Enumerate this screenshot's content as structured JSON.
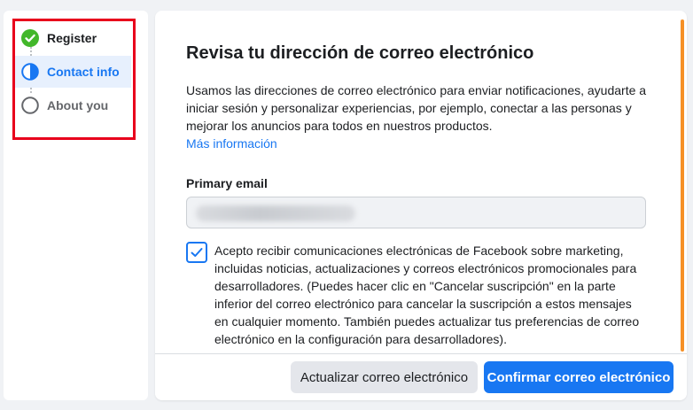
{
  "stepper": {
    "steps": [
      {
        "label": "Register",
        "state": "complete"
      },
      {
        "label": "Contact info",
        "state": "current"
      },
      {
        "label": "About you",
        "state": "pending"
      }
    ]
  },
  "main": {
    "title": "Revisa tu dirección de correo electrónico",
    "description": "Usamos las direcciones de correo electrónico para enviar notificaciones, ayudarte a iniciar sesión y personalizar experiencias, por ejemplo, conectar a las personas y mejorar los anuncios para todos en nuestros productos.",
    "more_info_link": "Más información",
    "email_label": "Primary email",
    "email_value": "",
    "consent_checked": true,
    "consent_text": "Acepto recibir comunicaciones electrónicas de Facebook sobre marketing, incluidas noticias, actualizaciones y correos electrónicos promocionales para desarrolladores. (Puedes hacer clic en \"Cancelar suscripción\" en la parte inferior del correo electrónico para cancelar la suscripción a estos mensajes en cualquier momento. También puedes actualizar tus preferencias de correo electrónico en la configuración para desarrolladores)."
  },
  "footer": {
    "update_button": "Actualizar correo electrónico",
    "confirm_button": "Confirmar correo electrónico"
  },
  "colors": {
    "accent": "#1877f2",
    "complete": "#42b72a",
    "highlight_box": "#e8001c"
  }
}
